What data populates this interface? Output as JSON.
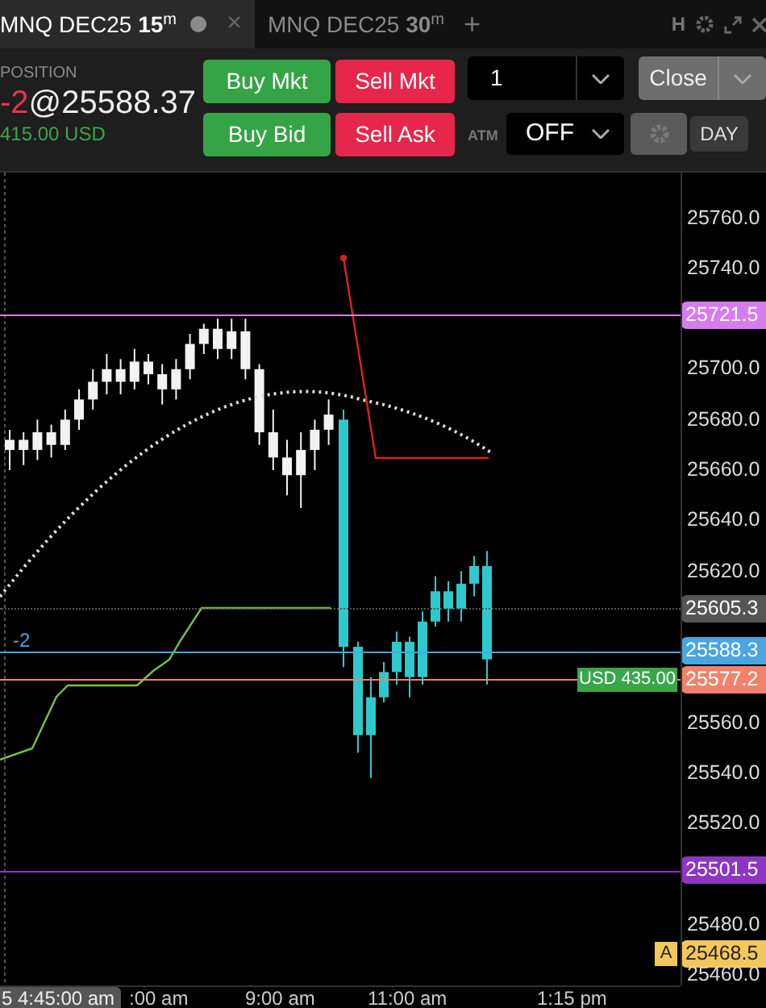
{
  "tabs": [
    {
      "symbol": "MNQ DEC25",
      "interval": "15",
      "unit": "m",
      "selected": true,
      "modified": true,
      "close": "×"
    },
    {
      "symbol": "MNQ DEC25",
      "interval": "30",
      "unit": "m",
      "selected": false
    }
  ],
  "add_tab": "+",
  "header_letter": "H",
  "position": {
    "label": "POSITION",
    "quantity": "-2",
    "price": "@25588.37",
    "pnl": "415.00 USD"
  },
  "order_buttons": [
    {
      "label": "Buy Mkt",
      "kind": "buy"
    },
    {
      "label": "Sell Mkt",
      "kind": "sell"
    },
    {
      "label": "Buy Bid",
      "kind": "buy"
    },
    {
      "label": "Sell Ask",
      "kind": "sell"
    }
  ],
  "quantity_field": {
    "value": "1"
  },
  "close_button": {
    "label": "Close"
  },
  "atm": {
    "label": "ATM",
    "value": "OFF"
  },
  "settings_button": {
    "disabled": true
  },
  "tif_button": {
    "label": "DAY"
  },
  "chart": {
    "price_ticks": [
      "25760.0",
      "25740.0",
      "25700.0",
      "25680.0",
      "25660.0",
      "25640.0",
      "25620.0",
      "25560.0",
      "25540.0",
      "25520.0",
      "25480.0",
      "25460.0"
    ],
    "price_markers": [
      {
        "label": "25721.5",
        "color": "#d77cef",
        "kind": "solid"
      },
      {
        "label": "25605.3",
        "color": "#555555",
        "kind": "dotted"
      },
      {
        "label": "25588.3",
        "color": "#4aa6e0",
        "kind": "solid"
      },
      {
        "label": "25577.2",
        "color": "#f0826c",
        "kind": "solid"
      },
      {
        "label": "25501.5",
        "color": "#8f35c4",
        "kind": "solid"
      },
      {
        "label": "25468.5",
        "color": "#f4c75a",
        "kind": "none"
      }
    ],
    "position_line": {
      "label": "-2"
    },
    "pnl_tag": {
      "label": "USD 435.00"
    },
    "alert_tag": {
      "label": "A"
    },
    "time_labels": [
      {
        "label": "5 4:45:00 am",
        "crosshair": true
      },
      {
        "label": ":00 am",
        "crosshair": false
      },
      {
        "label": "9:00 am",
        "crosshair": false
      },
      {
        "label": "11:00 am",
        "crosshair": false
      },
      {
        "label": "1:15 pm",
        "crosshair": false
      }
    ]
  }
}
